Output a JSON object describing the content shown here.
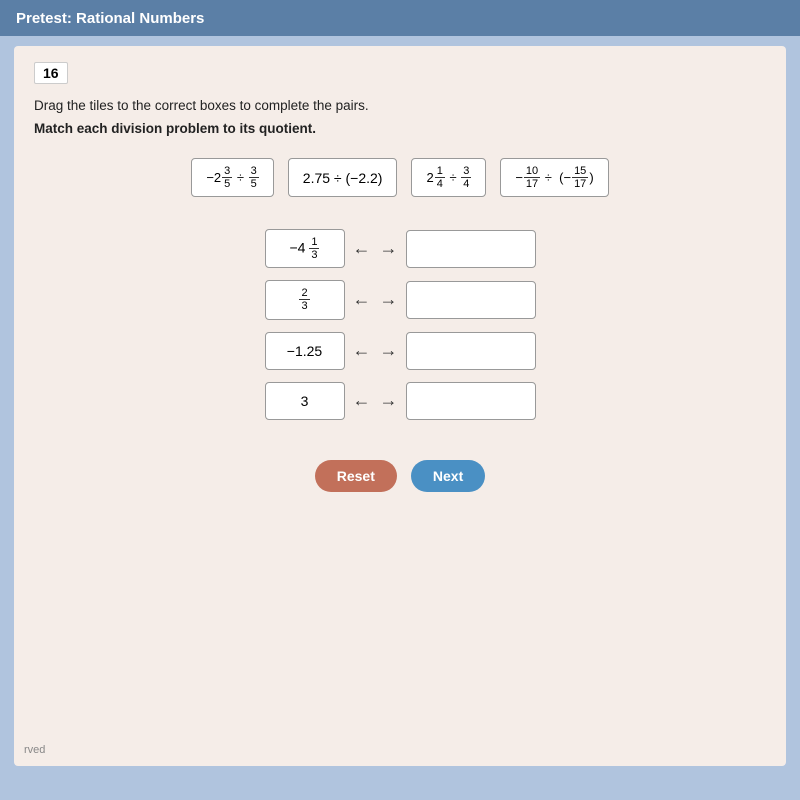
{
  "titleBar": {
    "label": "Pretest: Rational Numbers"
  },
  "questionNumber": "16",
  "instructions": {
    "line1": "Drag the tiles to the correct boxes to complete the pairs.",
    "line2": "Match each division problem to its quotient."
  },
  "tiles": [
    {
      "id": "tile1",
      "display": "-2&#8532; ÷ &#8540;",
      "latex": "-2_3/5 ÷ 3/5"
    },
    {
      "id": "tile2",
      "display": "2.75 ÷ (−2.2)",
      "latex": "2.75 ÷ (−2.2)"
    },
    {
      "id": "tile3",
      "display": "2¼ ÷ ¾",
      "latex": "2 1/4 ÷ 3/4"
    },
    {
      "id": "tile4",
      "display": "−10/17 ÷ (−15/17)",
      "latex": "−10/17 ÷ (−15/17)"
    }
  ],
  "pairs": [
    {
      "id": "pair1",
      "quotient": "−4⅓",
      "arrow": "↔"
    },
    {
      "id": "pair2",
      "quotient": "2/3",
      "arrow": "↔"
    },
    {
      "id": "pair3",
      "quotient": "−1.25",
      "arrow": "↔"
    },
    {
      "id": "pair4",
      "quotient": "3",
      "arrow": "↔"
    }
  ],
  "buttons": {
    "reset": "Reset",
    "next": "Next"
  },
  "footer": "rved"
}
